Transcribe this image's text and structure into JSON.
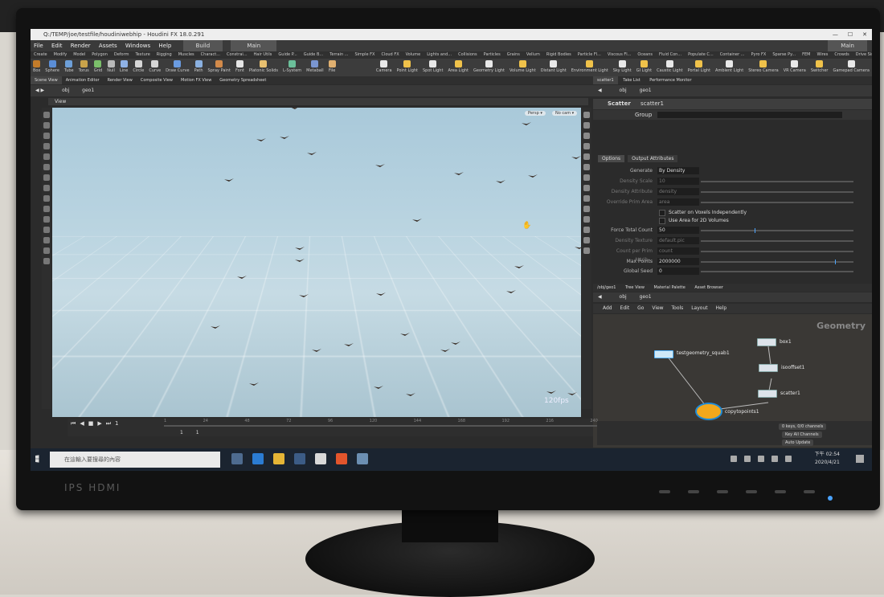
{
  "titlebar": {
    "title": "Q:/TEMP/joe/testfile/houdiniwebhip - Houdini FX 18.0.291"
  },
  "menubar": {
    "items": [
      "File",
      "Edit",
      "Render",
      "Assets",
      "Windows",
      "Help"
    ],
    "desktop": "Build",
    "main": "Main",
    "main_right": "Main"
  },
  "shelf_tabs": [
    "Create",
    "Modify",
    "Model",
    "Polygon",
    "Deform",
    "Texture",
    "Rigging",
    "Muscles",
    "Charact...",
    "Constrai...",
    "Hair Utils",
    "Guide P...",
    "Guide B...",
    "Terrain ...",
    "Simple FX",
    "Cloud FX",
    "Volume",
    "Lights and...",
    "Collisions",
    "Particles",
    "Grains",
    "Vellum",
    "Rigid Bodies",
    "Particle Fl...",
    "Viscous Fl...",
    "Oceans",
    "Fluid Con...",
    "Populate C...",
    "Container ...",
    "Pyro FX",
    "Sparse Py...",
    "FEM",
    "Wires",
    "Crowds",
    "Drive Sim"
  ],
  "shelf_tools_left": [
    "Box",
    "Sphere",
    "Tube",
    "Torus",
    "Grid",
    "Null",
    "Line",
    "Circle",
    "Curve",
    "Draw Curve",
    "Path",
    "Spray Paint",
    "Font",
    "Platonic Solids",
    "L-System",
    "Metaball",
    "File"
  ],
  "shelf_tools_right": [
    "Camera",
    "Point Light",
    "Spot Light",
    "Area Light",
    "Geometry Light",
    "Volume Light",
    "Distant Light",
    "Environment Light",
    "Sky Light",
    "GI Light",
    "Caustic Light",
    "Portal Light",
    "Ambient Light",
    "Stereo Camera",
    "VR Camera",
    "Switcher",
    "Gamepad Camera"
  ],
  "viewer_tabs": [
    "Scene View",
    "Animation Editor",
    "Render View",
    "Composite View",
    "Motion FX View",
    "Geometry Spreadsheet"
  ],
  "path": {
    "obj": "obj",
    "geo": "geo1"
  },
  "viewport": {
    "label": "View",
    "persp_btn": "Persp ▾",
    "cam_btn": "No cam ▾",
    "fps": "120fps"
  },
  "param_tabs": [
    "scatter1",
    "Take List",
    "Performance Monitor"
  ],
  "params": {
    "node_type": "Scatter",
    "node_name": "scatter1",
    "group_label": "Group",
    "tabs": [
      "Options",
      "Output Attributes"
    ],
    "rows": [
      {
        "label": "Generate",
        "value": "By Density",
        "dim": false
      },
      {
        "label": "Density Scale",
        "value": "10",
        "dim": true
      },
      {
        "label": "Density Attribute",
        "value": "density",
        "dim": true
      },
      {
        "label": "Override Prim Area",
        "value": "area",
        "dim": true
      },
      {
        "label": "",
        "value": "Scatter on Voxels Independently",
        "dim": false
      },
      {
        "label": "",
        "value": "Use Area for 2D Volumes",
        "dim": false
      },
      {
        "label": "Force Total Count",
        "value": "50",
        "dim": false
      },
      {
        "label": "Density Texture",
        "value": "default.pic",
        "dim": true
      },
      {
        "label": "Count per Prim Attrib...",
        "value": "count",
        "dim": true
      },
      {
        "label": "Max Points",
        "value": "2000000",
        "dim": false
      },
      {
        "label": "Global Seed",
        "value": "0",
        "dim": false
      }
    ]
  },
  "network": {
    "tabs": [
      "/obj/geo1",
      "Tree View",
      "Material Palette",
      "Asset Browser"
    ],
    "menu": [
      "Add",
      "Edit",
      "Go",
      "View",
      "Tools",
      "Layout",
      "Help"
    ],
    "context_label": "Geometry",
    "nodes": {
      "testgeometry": "testgeometry_squab1",
      "box": "box1",
      "isooffset": "isooffset1",
      "scatter": "scatter1",
      "copy": "copytopoints1"
    }
  },
  "timeline": {
    "frame": "1",
    "start": "1",
    "start2": "1",
    "end": "240",
    "end2": "240",
    "ticks": [
      "1",
      "24",
      "48",
      "72",
      "96",
      "120",
      "144",
      "168",
      "192",
      "216",
      "240"
    ],
    "keys_label": "0 keys, 0/0 channels",
    "key_all": "Key All Channels",
    "auto_update": "Auto Update"
  },
  "taskbar": {
    "search_placeholder": "在這輸入要搜尋的內容",
    "time": "下午 02:54",
    "date": "2020/4/21"
  },
  "monitor": {
    "brand": "IPS HDMI"
  }
}
